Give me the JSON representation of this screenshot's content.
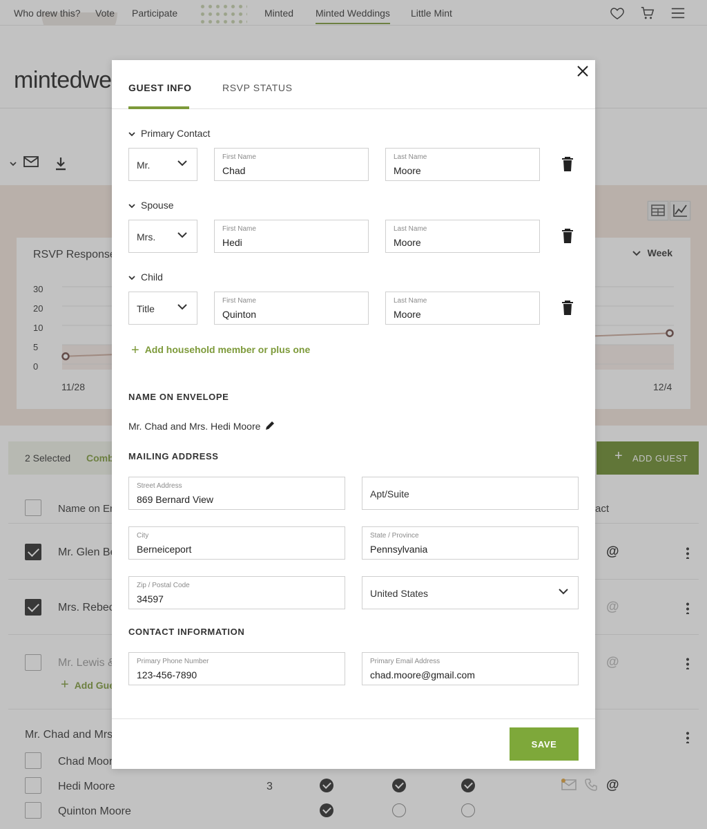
{
  "topnav": {
    "left_links": [
      "Who drew this?",
      "Vote",
      "Participate"
    ],
    "center_links": [
      "Minted",
      "Minted Weddings",
      "Little Mint"
    ],
    "active_link": "Minted Weddings"
  },
  "brand": {
    "logo_text": "mintedwe"
  },
  "chart_data": {
    "type": "line",
    "title": "RSVP Responses",
    "range_selector": "Week",
    "y_ticks": [
      30,
      20,
      10,
      5,
      0
    ],
    "x_ticks": [
      "11/28",
      "12/4"
    ],
    "ylim": [
      0,
      30
    ],
    "series": [
      {
        "values": [
          2,
          8
        ]
      }
    ]
  },
  "selection_bar": {
    "count_text": "2 Selected",
    "combine_text": "Comb"
  },
  "add_guest_label": "ADD GUEST",
  "table": {
    "header_name": "Name on Env",
    "header_contact": "act",
    "rows": [
      {
        "name": "Mr. Glen Be"
      },
      {
        "name": "Mrs. Rebec"
      },
      {
        "name": "Mr. Lewis &",
        "add_label": "Add Gue"
      }
    ],
    "group": {
      "name": "Mr. Chad and Mrs",
      "members": [
        {
          "name": "Chad Moore"
        },
        {
          "name": "Hedi Moore",
          "count": "3"
        },
        {
          "name": "Quinton Moore"
        }
      ]
    }
  },
  "modal": {
    "tabs": [
      "GUEST INFO",
      "RSVP STATUS"
    ],
    "primary": {
      "label": "Primary Contact",
      "title": "Mr.",
      "first_label": "First Name",
      "first": "Chad",
      "last_label": "Last Name",
      "last": "Moore"
    },
    "spouse": {
      "label": "Spouse",
      "title": "Mrs.",
      "first_label": "First Name",
      "first": "Hedi",
      "last_label": "Last Name",
      "last": "Moore"
    },
    "child": {
      "label": "Child",
      "title": "Title",
      "first_label": "First Name",
      "first": "Quinton",
      "last_label": "Last Name",
      "last": "Moore"
    },
    "add_member_label": "Add household member or plus one",
    "envelope": {
      "heading": "NAME ON ENVELOPE",
      "name": "Mr. Chad and Mrs. Hedi Moore"
    },
    "address": {
      "heading": "MAILING ADDRESS",
      "street_label": "Street Address",
      "street": "869 Bernard View",
      "apt_placeholder": "Apt/Suite",
      "city_label": "City",
      "city": "Berneiceport",
      "state_label": "State / Province",
      "state": "Pennsylvania",
      "zip_label": "Zip / Postal Code",
      "zip": "34597",
      "country": "United States"
    },
    "contact": {
      "heading": "CONTACT INFORMATION",
      "phone_label": "Primary Phone Number",
      "phone": "123-456-7890",
      "email_label": "Primary Email Address",
      "email": "chad.moore@gmail.com"
    },
    "save_label": "SAVE"
  }
}
